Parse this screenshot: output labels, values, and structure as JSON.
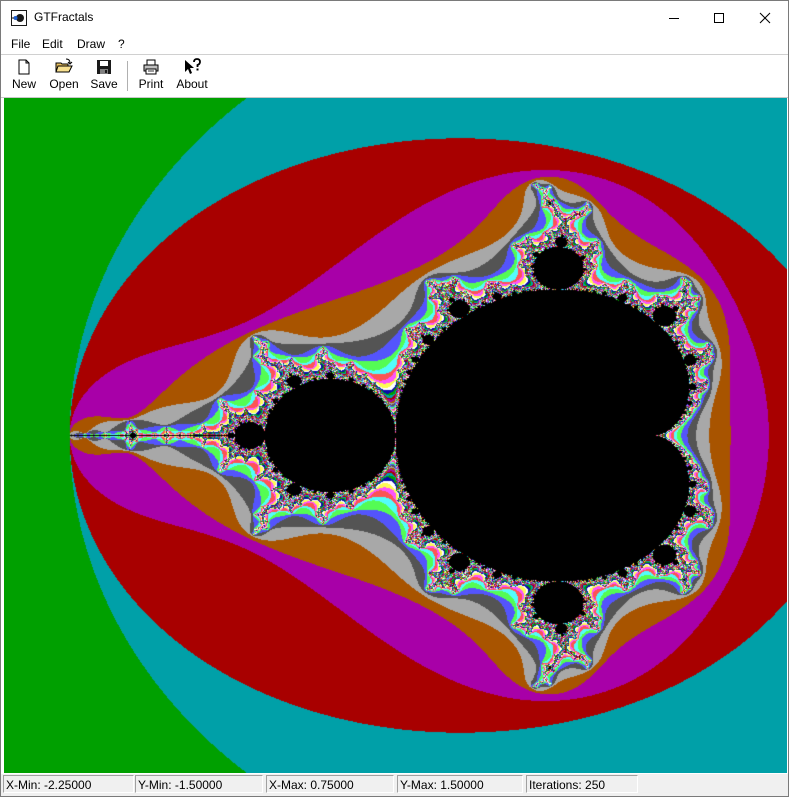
{
  "window": {
    "title": "GTFractals",
    "icon": "app-icon"
  },
  "menu": {
    "items": [
      "File",
      "Edit",
      "Draw",
      "?"
    ]
  },
  "toolbar": {
    "buttons": [
      {
        "label": "New",
        "icon": "new-document-icon"
      },
      {
        "label": "Open",
        "icon": "open-folder-icon"
      },
      {
        "label": "Save",
        "icon": "floppy-disk-icon"
      },
      {
        "label": "Print",
        "icon": "printer-icon"
      },
      {
        "label": "About",
        "icon": "help-pointer-icon"
      }
    ]
  },
  "fractal": {
    "type": "Mandelbrot",
    "x_min": -2.25,
    "x_max": 0.75,
    "y_min": -1.5,
    "y_max": 1.5,
    "iterations": 250,
    "palette": [
      "#0a0aa8",
      "#00a000",
      "#00a0a8",
      "#a80000",
      "#a800a8",
      "#a85400",
      "#a8a8a8",
      "#545454",
      "#5454fc",
      "#54fc54",
      "#54fcfc",
      "#fc5454",
      "#fc54fc",
      "#fcfc54",
      "#ffffff"
    ],
    "set_color": "#000000"
  },
  "status": {
    "xmin": "X-Min: -2.25000",
    "ymin": "Y-Min: -1.50000",
    "xmax": "X-Max: 0.75000",
    "ymax": "Y-Max: 1.50000",
    "iterations": "Iterations: 250"
  }
}
